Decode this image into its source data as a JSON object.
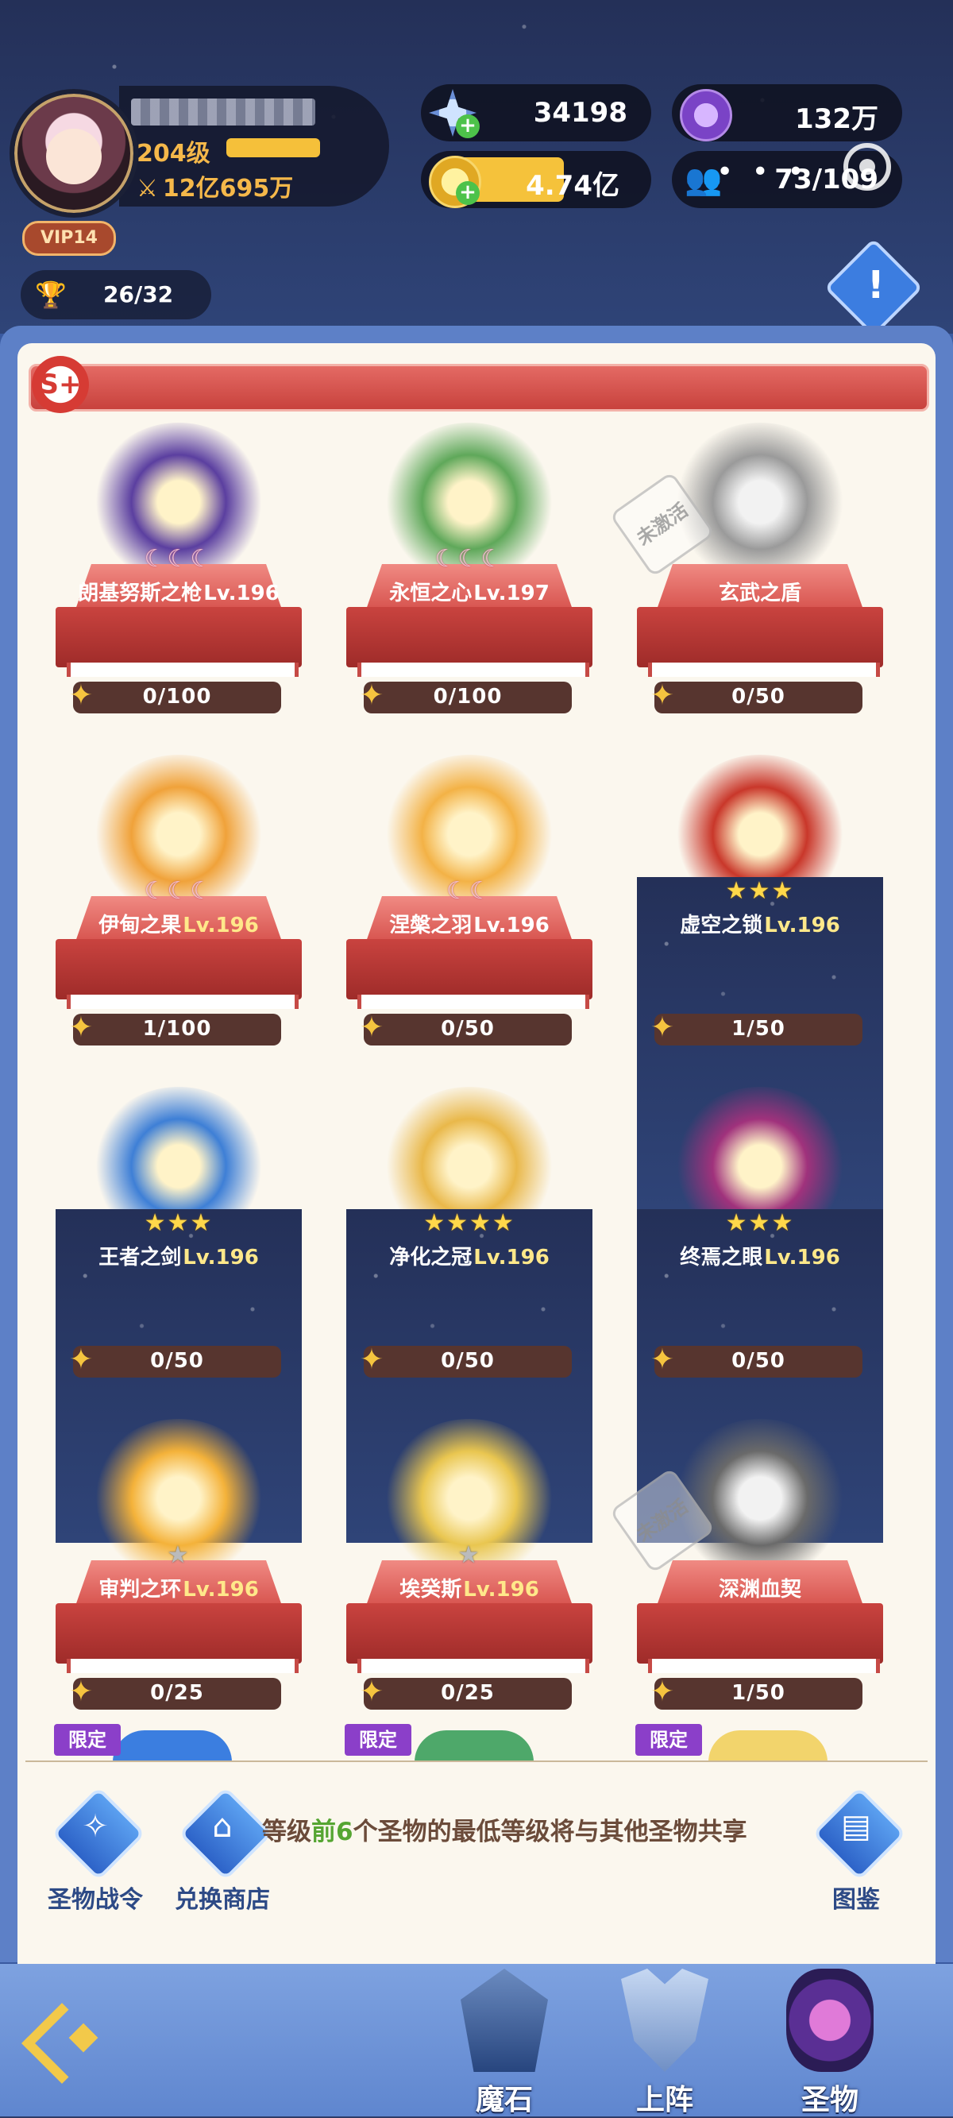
{
  "header": {
    "level": "204级",
    "power": "12亿695万",
    "vip": "VIP14",
    "trophy": "26/32",
    "diamond": "34198",
    "purple_currency": "132万",
    "gold": "4.74亿",
    "friends": "73/109"
  },
  "panel": {
    "tier_badge": "S+",
    "relics": [
      {
        "name": "朗基努斯之枪",
        "level": "Lv.196",
        "level_color": "white",
        "marks": "moons",
        "mark_count": 3,
        "fragments": "0/100",
        "active": true,
        "art_color": "#5b3fa0"
      },
      {
        "name": "永恒之心",
        "level": "Lv.197",
        "level_color": "white",
        "marks": "moons",
        "mark_count": 3,
        "fragments": "0/100",
        "active": true,
        "art_color": "#5fa85a"
      },
      {
        "name": "玄武之盾",
        "level": "",
        "level_color": "white",
        "marks": "none",
        "mark_count": 0,
        "fragments": "0/50",
        "active": false,
        "art_color": "#9a9a9a"
      },
      {
        "name": "伊甸之果",
        "level": "Lv.196",
        "level_color": "yellow",
        "marks": "moons",
        "mark_count": 3,
        "fragments": "1/100",
        "active": true,
        "art_color": "#f0a23a"
      },
      {
        "name": "涅槃之羽",
        "level": "Lv.196",
        "level_color": "white",
        "marks": "moons",
        "mark_count": 2,
        "fragments": "0/50",
        "active": true,
        "art_color": "#f3b246"
      },
      {
        "name": "虚空之锁",
        "level": "Lv.196",
        "level_color": "yellow",
        "marks": "stars",
        "mark_count": 3,
        "fragments": "1/50",
        "active": true,
        "art_color": "#c9372a"
      },
      {
        "name": "王者之剑",
        "level": "Lv.196",
        "level_color": "yellow",
        "marks": "stars",
        "mark_count": 3,
        "fragments": "0/50",
        "active": true,
        "art_color": "#3e7fd6"
      },
      {
        "name": "净化之冠",
        "level": "Lv.196",
        "level_color": "yellow",
        "marks": "stars",
        "mark_count": 4,
        "fragments": "0/50",
        "active": true,
        "art_color": "#e9b84a"
      },
      {
        "name": "终焉之眼",
        "level": "Lv.196",
        "level_color": "yellow",
        "marks": "stars",
        "mark_count": 3,
        "fragments": "0/50",
        "active": true,
        "art_color": "#a0327c"
      },
      {
        "name": "审判之环",
        "level": "Lv.196",
        "level_color": "yellow",
        "marks": "gray",
        "mark_count": 1,
        "fragments": "0/25",
        "active": true,
        "art_color": "#f4b23a"
      },
      {
        "name": "埃癸斯",
        "level": "Lv.196",
        "level_color": "yellow",
        "marks": "gray",
        "mark_count": 1,
        "fragments": "0/25",
        "active": true,
        "art_color": "#e9c650"
      },
      {
        "name": "深渊血契",
        "level": "",
        "level_color": "white",
        "marks": "none",
        "mark_count": 0,
        "fragments": "1/50",
        "active": false,
        "art_color": "#6a6a6a"
      }
    ],
    "inactive_label": "未激活",
    "limited_label": "限定"
  },
  "footer": {
    "battle_pass": "圣物战令",
    "exchange_shop": "兑换商店",
    "collection": "图鉴",
    "share_text_a": "等级",
    "share_text_b": "前6",
    "share_text_c": "个圣物的最低等级将与其他圣物共享"
  },
  "nav": {
    "magic_stone": "魔石",
    "deploy": "上阵",
    "relic": "圣物"
  }
}
